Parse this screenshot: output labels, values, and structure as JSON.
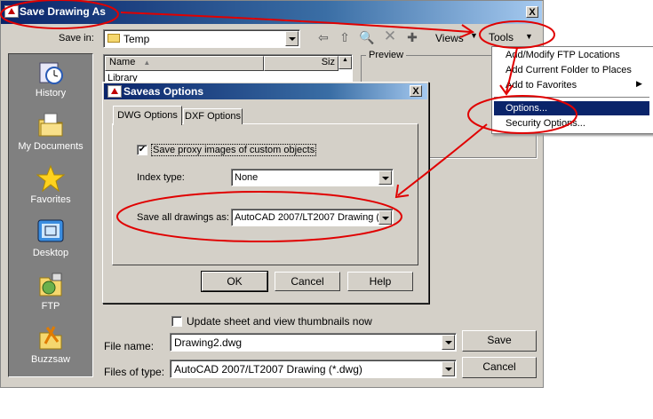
{
  "window": {
    "title": "Save Drawing As",
    "close_label": "X"
  },
  "toolbar": {
    "save_in_label": "Save in:",
    "save_in_value": "Temp",
    "views_label": "Views",
    "tools_label": "Tools"
  },
  "places": [
    {
      "label": "History",
      "icon": "history-icon"
    },
    {
      "label": "My Documents",
      "icon": "my-documents-icon"
    },
    {
      "label": "Favorites",
      "icon": "favorites-icon"
    },
    {
      "label": "Desktop",
      "icon": "desktop-icon"
    },
    {
      "label": "FTP",
      "icon": "ftp-icon"
    },
    {
      "label": "Buzzsaw",
      "icon": "buzzsaw-icon"
    }
  ],
  "file_list": {
    "col_name": "Name",
    "col_size": "Siz",
    "first_item": "Library"
  },
  "preview_label": "Preview",
  "tools_menu": {
    "items": [
      "Add/Modify FTP Locations",
      "Add Current Folder to Places",
      "Add to Favorites",
      "Options...",
      "Security Options..."
    ]
  },
  "saveas_dialog": {
    "title": "Saveas Options",
    "close_label": "X",
    "tabs": [
      "DWG Options",
      "DXF Options"
    ],
    "proxy_checkbox_label": "Save proxy images of custom objects",
    "proxy_checked": "✔",
    "index_type_label": "Index type:",
    "index_type_value": "None",
    "save_all_label": "Save all drawings as:",
    "save_all_value": "AutoCAD 2007/LT2007 Drawing (",
    "ok_label": "OK",
    "cancel_label": "Cancel",
    "help_label": "Help"
  },
  "bottom": {
    "thumbnail_label": "Update sheet and view thumbnails now",
    "file_name_label": "File name:",
    "file_name_value": "Drawing2.dwg",
    "file_type_label": "Files of type:",
    "file_type_value": "AutoCAD 2007/LT2007 Drawing (*.dwg)",
    "save_label": "Save",
    "cancel_label": "Cancel"
  },
  "annotation_color": "#e00000"
}
